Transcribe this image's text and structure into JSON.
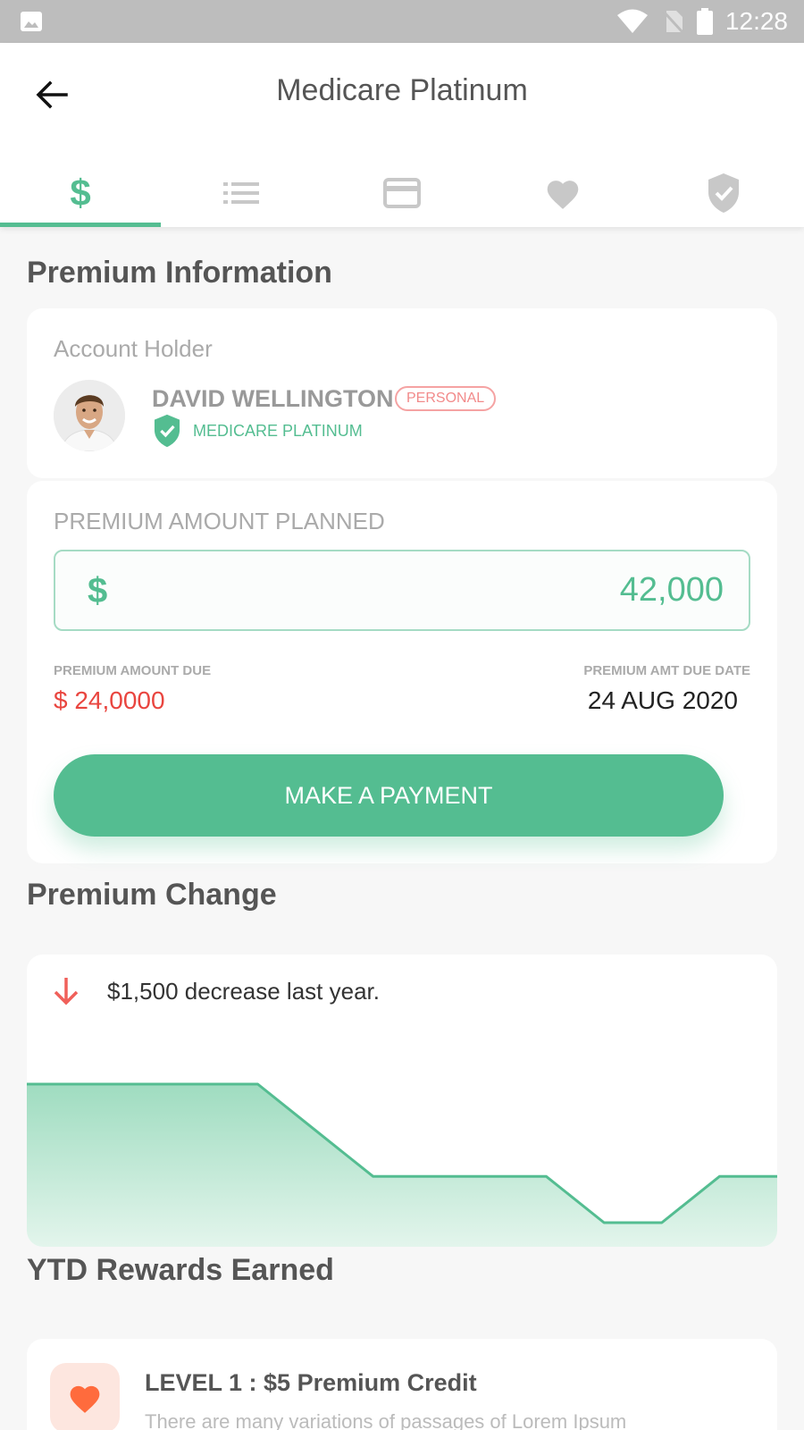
{
  "status_bar": {
    "time": "12:28"
  },
  "header": {
    "title": "Medicare Platinum"
  },
  "tabs": [
    {
      "icon": "dollar-icon",
      "label": "$",
      "active": true
    },
    {
      "icon": "list-icon",
      "active": false
    },
    {
      "icon": "credit-card-icon",
      "active": false
    },
    {
      "icon": "heart-icon",
      "active": false
    },
    {
      "icon": "shield-check-icon",
      "active": false
    }
  ],
  "premium_info": {
    "section_title": "Premium Information",
    "account_holder_label": "Account Holder",
    "name": "DAVID WELLINGTON",
    "badge": "PERSONAL",
    "plan": "MEDICARE PLATINUM",
    "amount_planned_label": "PREMIUM AMOUNT PLANNED",
    "currency_symbol": "$",
    "amount_planned_value": "42,000",
    "amount_due_label": "PREMIUM AMOUNT DUE",
    "amount_due_value": "$ 24,0000",
    "due_date_label": "PREMIUM AMT DUE DATE",
    "due_date_value": "24 AUG 2020",
    "pay_button": "MAKE A PAYMENT"
  },
  "premium_change": {
    "section_title": "Premium Change",
    "summary": "$1,500 decrease last year.",
    "chart_data": {
      "type": "area",
      "x": [
        0,
        1,
        2,
        3,
        4,
        5,
        6,
        7,
        8,
        9,
        10,
        11,
        12,
        13
      ],
      "values": [
        3,
        3,
        3,
        3,
        3,
        2,
        1,
        1,
        1,
        1,
        0,
        0,
        1,
        1
      ],
      "title": "",
      "xlabel": "",
      "ylabel": "",
      "ylim": [
        0,
        3
      ],
      "grid": false,
      "colors": {
        "line": "#54bd91",
        "fill_top": "#9fdcc0",
        "fill_bottom": "#e3f5ec"
      }
    }
  },
  "rewards": {
    "section_title": "YTD Rewards Earned",
    "items": [
      {
        "icon": "heart-icon",
        "title": "LEVEL 1 : $5 Premium Credit",
        "description": "There are many variations of passages of Lorem Ipsum"
      }
    ]
  },
  "colors": {
    "accent": "#54bd91",
    "danger": "#e9453f",
    "reward_icon": "#ff6b3d"
  }
}
